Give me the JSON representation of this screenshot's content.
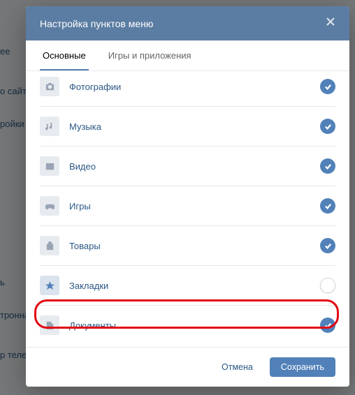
{
  "modal": {
    "title": "Настройка пунктов меню",
    "tabs": [
      {
        "label": "Основные",
        "active": true
      },
      {
        "label": "Игры и приложения",
        "active": false
      }
    ],
    "items": [
      {
        "label": "Фотографии",
        "icon": "camera",
        "enabled": true
      },
      {
        "label": "Музыка",
        "icon": "music",
        "enabled": true
      },
      {
        "label": "Видео",
        "icon": "video",
        "enabled": true
      },
      {
        "label": "Игры",
        "icon": "gamepad",
        "enabled": true
      },
      {
        "label": "Товары",
        "icon": "bag",
        "enabled": true
      },
      {
        "label": "Закладки",
        "icon": "star",
        "enabled": false,
        "highlighted": true
      },
      {
        "label": "Документы",
        "icon": "document",
        "enabled": true
      }
    ],
    "footer": {
      "cancel": "Отмена",
      "save": "Сохранить"
    }
  },
  "background": {
    "items": [
      "ee",
      "о сайта",
      "ройки",
      "ь",
      "тронна",
      "р теле"
    ]
  }
}
